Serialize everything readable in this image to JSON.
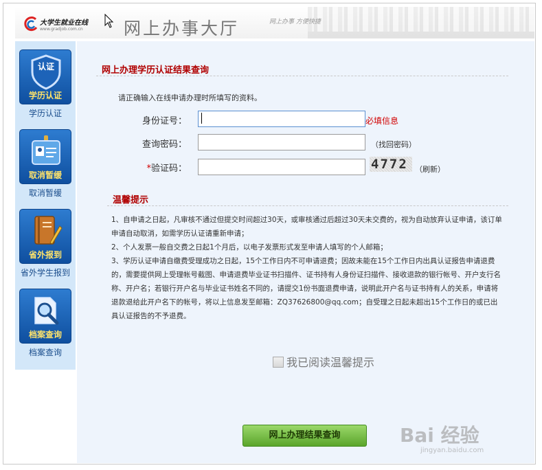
{
  "header": {
    "logo_text": "大学生就业在线",
    "logo_url": "www.gradjob.com.cn",
    "hall_title": "网上办事大厅",
    "hall_subtitle": "网上办事 方便快捷"
  },
  "sidebar": {
    "items": [
      {
        "tile_label": "学历认证",
        "caption": "学历认证",
        "icon": "shield-icon",
        "tile_glyph": "认证"
      },
      {
        "tile_label": "取消暂缓",
        "caption": "取消暂缓",
        "icon": "id-badge-icon"
      },
      {
        "tile_label": "省外报到",
        "caption": "省外学生报到",
        "icon": "notebook-icon"
      },
      {
        "tile_label": "档案查询",
        "caption": "档案查询",
        "icon": "magnifier-icon"
      }
    ]
  },
  "form": {
    "title": "网上办理学历认证结果查询",
    "instruction": "请正确输入在线申请办理时所填写的资料。",
    "id_label": "身份证号：",
    "id_value": "",
    "required_note": "必填信息",
    "password_label": "查询密码：",
    "password_value": "",
    "recover_link": "（找回密码）",
    "captcha_star": "*",
    "captcha_label": "验证码：",
    "captcha_value": "",
    "captcha_text": "4772",
    "refresh_link": "（刷新）"
  },
  "tips": {
    "title": "温馨提示",
    "lines": [
      "1、自申请之日起，凡审核不通过但提交时间超过30天，或审核通过后超过30天未交费的，视为自动放弃认证申请，该订单申请自动取消，如需学历认证请重新申请；",
      "2、个人发票一般自交费之日起1个月后，以电子发票形式发至申请人填写的个人邮箱；",
      "3、学历认证申请自缴费受理成功之日起，15个工作日内不可申请退费；因故未能在15个工作日内出具认证报告申请退费的，需要提供网上受理帐号截图、申请退费毕业证书扫描件、证书持有人身份证扫描件、接收退款的银行帐号、开户支行名称、开户名；若银行开户名与毕业证书姓名不同的，请提交1份书面退费申请，说明此开户名与证书持有人的关系，申请将退款退给此开户名下的帐号，将以上信息发至邮箱：ZQ37626800@qq.com；自受理之日起未超出15个工作日的或已出具认证报告的不予退费。"
    ]
  },
  "ack_label": "我已阅读温馨提示",
  "submit_label": "网上办理结果查询",
  "watermark": {
    "main": "Bai 经验",
    "sub": "jingyan.baidu.com"
  },
  "colors": {
    "accent_red": "#b00000",
    "sidebar_bg": "#d3e7f9",
    "main_bg": "#eef4fc",
    "button_green": "#5aa52b",
    "tile_blue": "#0f4f9f"
  }
}
